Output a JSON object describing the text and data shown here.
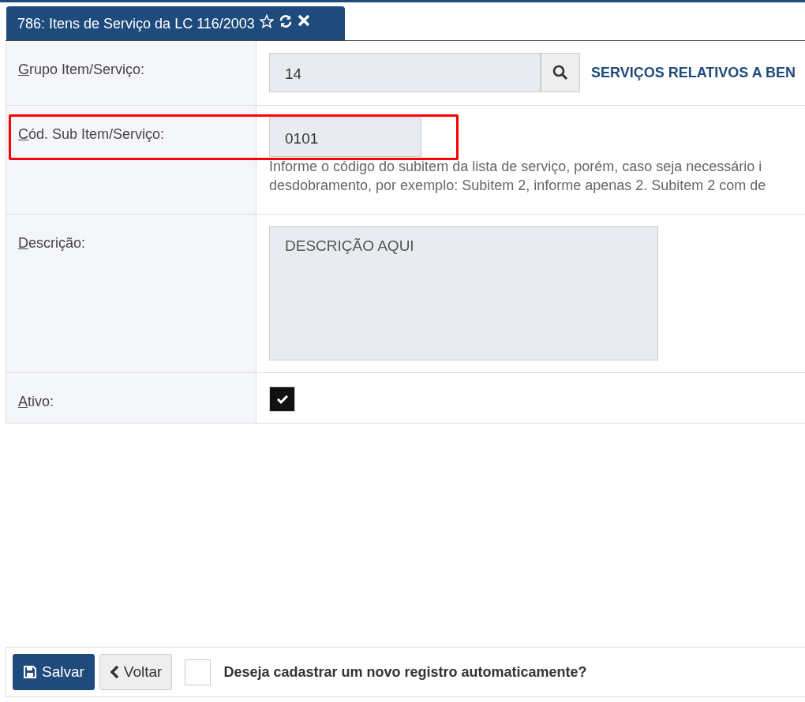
{
  "tab": {
    "title": "786: Itens de Serviço da LC 116/2003",
    "favorite": false
  },
  "fields": [
    {
      "kind": "lookup",
      "label": "Grupo Item/Serviço:",
      "value": "14",
      "description": "SERVIÇOS RELATIVOS A BEN",
      "highlighted": false
    },
    {
      "kind": "code",
      "label": "Cód. Sub Item/Serviço:",
      "value": "0101",
      "hints": [
        "Informe o código do subitem da lista de serviço, porém, caso seja necessário i",
        "desdobramento, por exemplo: Subitem 2, informe apenas 2. Subitem 2 com de"
      ],
      "highlighted": true
    },
    {
      "kind": "textarea",
      "label": "Descrição:",
      "value": "DESCRIÇÃO AQUI",
      "highlighted": false
    },
    {
      "kind": "checkbox",
      "label": "Ativo:",
      "checked": true,
      "highlighted": false
    }
  ],
  "footer": {
    "save": "Salvar",
    "back": "Voltar",
    "auto_new": {
      "label": "Deseja cadastrar um novo registro automaticamente?",
      "checked": false
    }
  }
}
